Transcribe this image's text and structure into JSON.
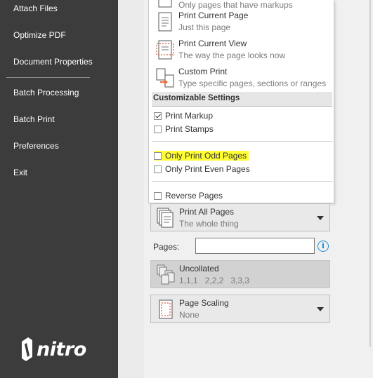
{
  "sidebar": {
    "items": [
      {
        "label": "Attach Files"
      },
      {
        "label": "Optimize PDF"
      },
      {
        "label": "Document Properties"
      },
      {
        "label": "Batch Processing"
      },
      {
        "label": "Batch Print"
      },
      {
        "label": "Preferences"
      },
      {
        "label": "Exit"
      }
    ],
    "logo_text": "nitro"
  },
  "print_menu": {
    "options": [
      {
        "title": "",
        "subtitle": "Only pages that have markups",
        "icon": "markup-pages-icon"
      },
      {
        "title": "Print Current Page",
        "subtitle": "Just this page",
        "icon": "single-page-icon"
      },
      {
        "title": "Print Current View",
        "subtitle": "The way the page looks now",
        "icon": "current-view-icon"
      },
      {
        "title": "Custom Print",
        "subtitle": "Type specific pages, sections or ranges",
        "icon": "custom-print-icon"
      }
    ],
    "section_header": "Customizable Settings",
    "checkboxes": [
      {
        "label": "Print Markup",
        "checked": true
      },
      {
        "label": "Print Stamps",
        "checked": false
      },
      {
        "label": "Only Print Odd Pages",
        "checked": false,
        "highlighted": true
      },
      {
        "label": "Only Print Even Pages",
        "checked": false
      },
      {
        "label": "Reverse Pages",
        "checked": false
      }
    ]
  },
  "print_range": {
    "title": "Print All Pages",
    "subtitle": "The whole thing"
  },
  "pages": {
    "label": "Pages:",
    "value": "",
    "info_icon": "info-icon"
  },
  "collation": {
    "title": "Uncollated",
    "subtitle": "1,1,1   2,2,2   3,3,3"
  },
  "scaling": {
    "title": "Page Scaling",
    "subtitle": "None"
  },
  "colors": {
    "sidebar_bg": "#3c3c3c",
    "highlight": "#ffff33",
    "accent": "#1a8fd4"
  }
}
